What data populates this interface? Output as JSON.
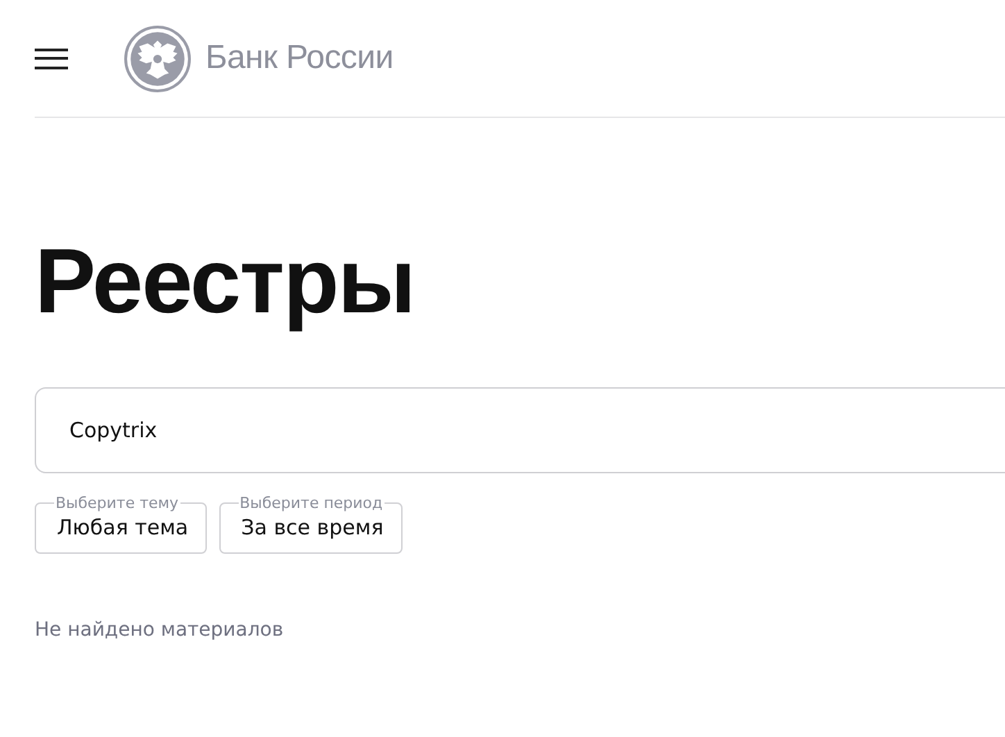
{
  "header": {
    "logo_text": "Банк России"
  },
  "title": "Реестры",
  "search": {
    "value": "Copytrix"
  },
  "filters": [
    {
      "label": "Выберите тему",
      "value": "Любая тема"
    },
    {
      "label": "Выберите период",
      "value": "За все время"
    }
  ],
  "message": "Не найдено материалов"
}
